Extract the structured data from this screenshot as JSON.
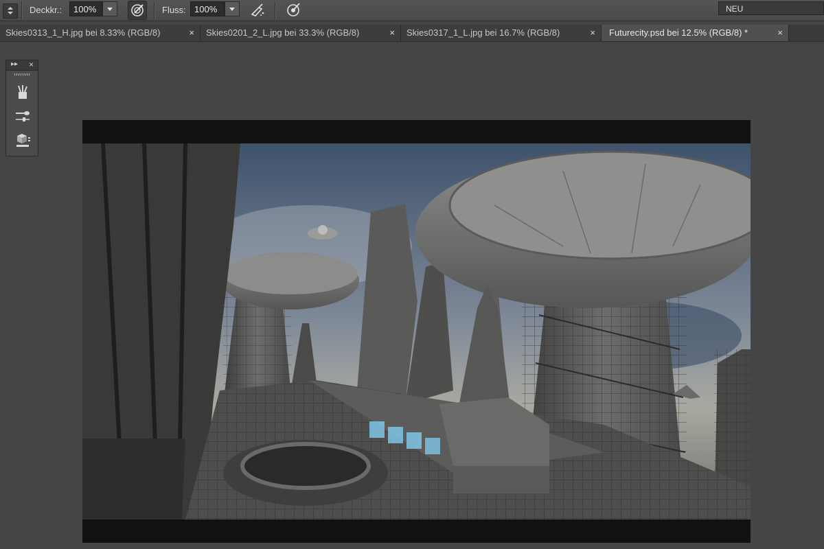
{
  "options_bar": {
    "opacity_label": "Deckkr.:",
    "opacity_value": "100%",
    "flow_label": "Fluss:",
    "flow_value": "100%",
    "icons": [
      "stepper-icon",
      "pressure-opacity-icon",
      "airbrush-icon",
      "pressure-size-icon"
    ],
    "workspace_label": "NEU"
  },
  "tabs": [
    {
      "label": "Skies0313_1_H.jpg bei 8.33% (RGB/8)",
      "close": "×",
      "active": false
    },
    {
      "label": "Skies0201_2_L.jpg bei 33.3% (RGB/8)",
      "close": "×",
      "active": false
    },
    {
      "label": "Skies0317_1_L.jpg bei 16.7% (RGB/8)",
      "close": "×",
      "active": false
    },
    {
      "label": "Futurecity.psd bei 12.5% (RGB/8) *",
      "close": "×",
      "active": true
    }
  ],
  "panel": {
    "collapse_glyph": "▸▸",
    "close_glyph": "×",
    "icons": [
      "brush-presets-icon",
      "brush-settings-icon",
      "clone-source-icon"
    ]
  },
  "canvas": {
    "document_name": "Futurecity.psd",
    "colors": {
      "sky_top": "#4a5f7c",
      "sky_mid": "#8b97a6",
      "structure": "#5e5e5e",
      "shadow": "#262626",
      "glow": "#7fc6e6"
    }
  }
}
